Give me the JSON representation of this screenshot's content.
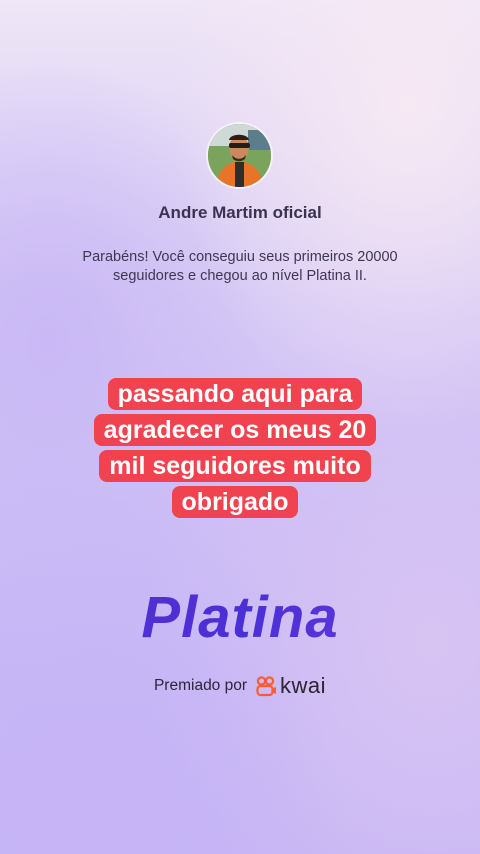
{
  "profile": {
    "avatar_icon": "user-avatar",
    "name": "Andre Martim oficial"
  },
  "message": {
    "line1": "Parabéns! Você conseguiu seus primeiros 20000",
    "line2": "seguidores e chegou ao nível Platina II."
  },
  "caption": {
    "text": "passando aqui para agradecer os meus 20 mil  seguidores muito obrigado",
    "background_color": "#f0424f"
  },
  "level": {
    "name": "Platina",
    "color": "#5a33d6"
  },
  "award": {
    "label": "Premiado por",
    "brand_icon": "kwai-logo-icon",
    "brand_name": "kwai",
    "brand_color": "#ff5b2e"
  }
}
